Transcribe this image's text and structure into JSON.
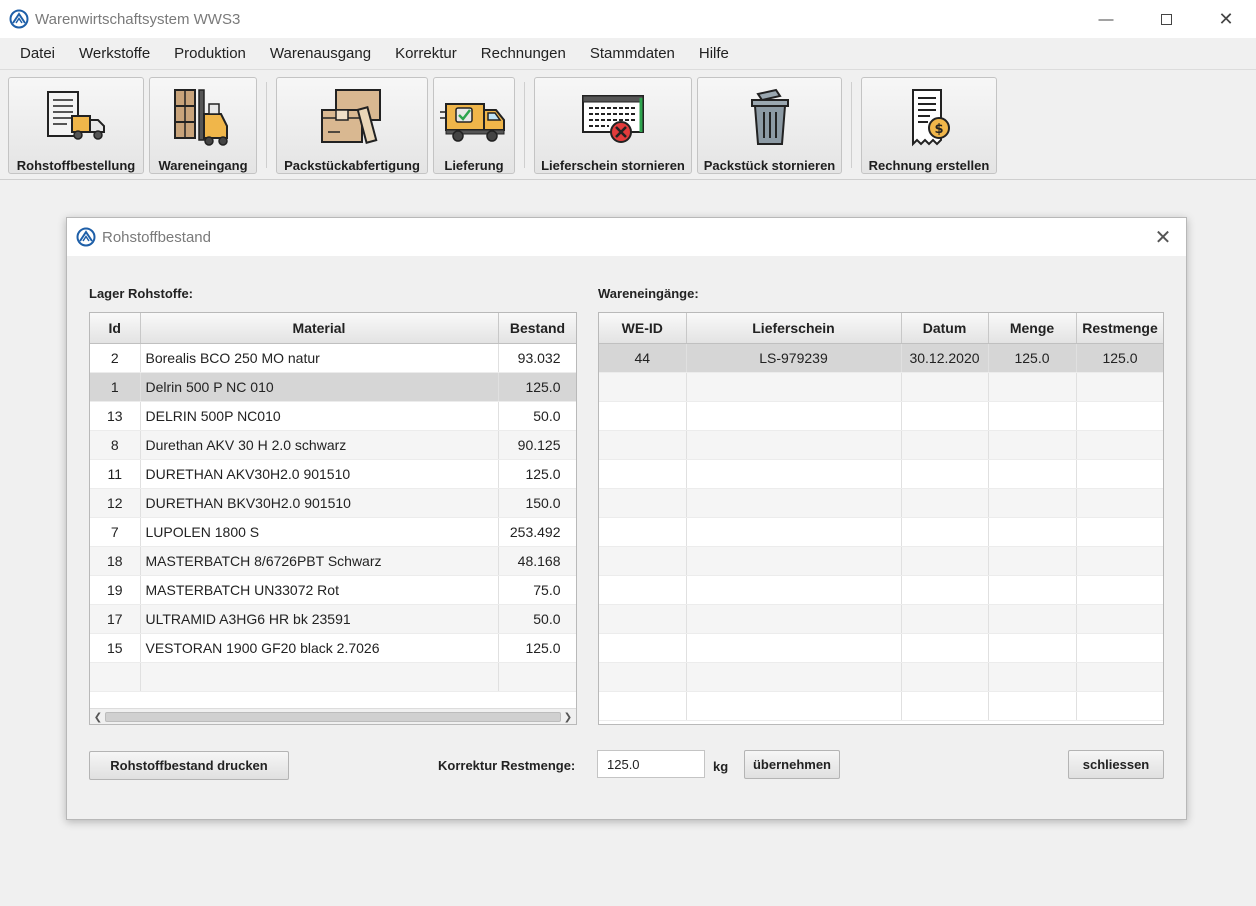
{
  "window": {
    "title": "Warenwirtschaftsystem WWS3"
  },
  "menu": [
    "Datei",
    "Werkstoffe",
    "Produktion",
    "Warenausgang",
    "Korrektur",
    "Rechnungen",
    "Stammdaten",
    "Hilfe"
  ],
  "toolbar": [
    {
      "label": "Rohstoffbestellung",
      "icon": "purchase-order-truck-icon"
    },
    {
      "label": "Wareneingang",
      "icon": "forklift-boxes-icon"
    },
    {
      "label": "Packstückabfertigung",
      "icon": "package-boxes-icon"
    },
    {
      "label": "Lieferung",
      "icon": "delivery-truck-check-icon"
    },
    {
      "label": "Lieferschein stornieren",
      "icon": "delivery-note-cancel-icon"
    },
    {
      "label": "Packstück stornieren",
      "icon": "trash-bin-icon"
    },
    {
      "label": "Rechnung erstellen",
      "icon": "invoice-dollar-icon"
    }
  ],
  "dialog": {
    "title": "Rohstoffbestand",
    "left_label": "Lager Rohstoffe:",
    "right_label": "Wareneingänge:",
    "stock_table": {
      "columns": [
        "Id",
        "Material",
        "Bestand"
      ],
      "rows": [
        {
          "id": "2",
          "material": "Borealis BCO 250 MO natur",
          "bestand": "93.032"
        },
        {
          "id": "1",
          "material": "Delrin 500 P NC 010",
          "bestand": "125.0"
        },
        {
          "id": "13",
          "material": "DELRIN 500P NC010",
          "bestand": "50.0"
        },
        {
          "id": "8",
          "material": "Durethan AKV 30 H 2.0  schwarz",
          "bestand": "90.125"
        },
        {
          "id": "11",
          "material": "DURETHAN AKV30H2.0 901510",
          "bestand": "125.0"
        },
        {
          "id": "12",
          "material": "DURETHAN BKV30H2.0 901510",
          "bestand": "150.0"
        },
        {
          "id": "7",
          "material": "LUPOLEN 1800 S",
          "bestand": "253.492"
        },
        {
          "id": "18",
          "material": "MASTERBATCH 8/6726PBT Schwarz",
          "bestand": "48.168"
        },
        {
          "id": "19",
          "material": "MASTERBATCH UN33072 Rot",
          "bestand": "75.0"
        },
        {
          "id": "17",
          "material": "ULTRAMID A3HG6 HR bk 23591",
          "bestand": "50.0"
        },
        {
          "id": "15",
          "material": "VESTORAN 1900 GF20 black 2.7026",
          "bestand": "125.0"
        }
      ]
    },
    "receipts_table": {
      "columns": [
        "WE-ID",
        "Lieferschein",
        "Datum",
        "Menge",
        "Restmenge"
      ],
      "rows": [
        {
          "weid": "44",
          "lieferschein": "LS-979239",
          "datum": "30.12.2020",
          "menge": "125.0",
          "restmenge": "125.0"
        }
      ]
    },
    "print_button": "Rohstoffbestand drucken",
    "correction_label": "Korrektur Restmenge:",
    "correction_value": "125.0",
    "unit": "kg",
    "apply_button": "übernehmen",
    "close_button": "schliessen"
  },
  "colors": {
    "selected_row": "#d6d6d6",
    "accent_logo": "#1e5fa8"
  }
}
